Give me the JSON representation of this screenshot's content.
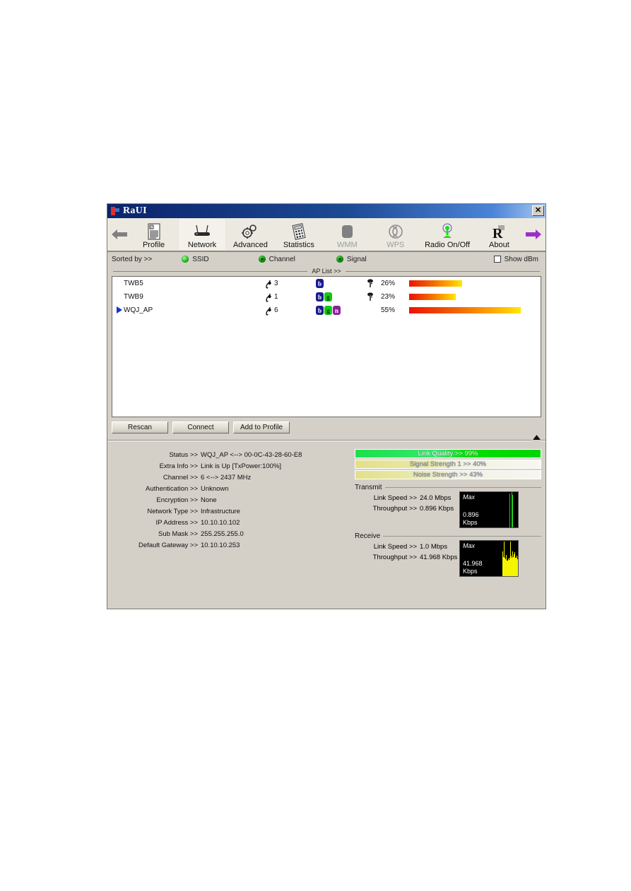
{
  "window": {
    "title": "RaUI",
    "close_label": "✕",
    "title_icon": "raui-logo-icon"
  },
  "toolbar": {
    "prev_arrow": "left-arrow-icon",
    "next_arrow": "right-arrow-icon",
    "tabs": [
      {
        "label": "Profile",
        "icon": "profile-icon",
        "active": false,
        "disabled": false
      },
      {
        "label": "Network",
        "icon": "router-icon",
        "active": true,
        "disabled": false
      },
      {
        "label": "Advanced",
        "icon": "gears-icon",
        "active": false,
        "disabled": false
      },
      {
        "label": "Statistics",
        "icon": "calculator-icon",
        "active": false,
        "disabled": false
      },
      {
        "label": "WMM",
        "icon": "wmm-icon",
        "active": false,
        "disabled": true
      },
      {
        "label": "WPS",
        "icon": "wps-icon",
        "active": false,
        "disabled": true
      },
      {
        "label": "Radio On/Off",
        "icon": "antenna-icon",
        "active": false,
        "disabled": false
      },
      {
        "label": "About",
        "icon": "about-r-icon",
        "active": false,
        "disabled": false
      }
    ]
  },
  "sortbar": {
    "label": "Sorted by >>",
    "options": [
      {
        "label": "SSID",
        "selected": true
      },
      {
        "label": "Channel",
        "selected": false
      },
      {
        "label": "Signal",
        "selected": false
      }
    ],
    "show_dbm": {
      "label": "Show dBm",
      "checked": false
    }
  },
  "aplist": {
    "separator_label": "AP List >>",
    "rows": [
      {
        "selected": false,
        "ssid": "TWB5",
        "channel": "3",
        "modes": [
          "b"
        ],
        "secured": true,
        "signal_pct": "26%",
        "signal_value": 26
      },
      {
        "selected": false,
        "ssid": "TWB9",
        "channel": "1",
        "modes": [
          "b",
          "g"
        ],
        "secured": true,
        "signal_pct": "23%",
        "signal_value": 23
      },
      {
        "selected": true,
        "ssid": "WQJ_AP",
        "channel": "6",
        "modes": [
          "b",
          "g",
          "n"
        ],
        "secured": false,
        "signal_pct": "55%",
        "signal_value": 55
      }
    ]
  },
  "actions": {
    "rescan": "Rescan",
    "connect": "Connect",
    "add_to_profile": "Add to Profile",
    "collapse": "collapse-triangle-icon"
  },
  "status_details": [
    {
      "label": "Status >>",
      "value": "WQJ_AP <--> 00-0C-43-28-60-E8"
    },
    {
      "label": "Extra Info >>",
      "value": "Link is Up [TxPower:100%]"
    },
    {
      "label": "Channel >>",
      "value": "6 <--> 2437 MHz"
    },
    {
      "label": "Authentication >>",
      "value": "Unknown"
    },
    {
      "label": "Encryption >>",
      "value": "None"
    },
    {
      "label": "Network Type >>",
      "value": "Infrastructure"
    },
    {
      "label": "IP Address >>",
      "value": "10.10.10.102"
    },
    {
      "label": "Sub Mask >>",
      "value": "255.255.255.0"
    },
    {
      "label": "Default Gateway >>",
      "value": "10.10.10.253"
    }
  ],
  "quality_bars": [
    {
      "label": "Link Quality >> 99%",
      "value": 99
    },
    {
      "label": "Signal Strength 1 >> 40%",
      "value": 40
    },
    {
      "label": "Noise Strength >> 43%",
      "value": 43
    }
  ],
  "transmit": {
    "title": "Transmit",
    "link_speed_label": "Link Speed >>",
    "link_speed_value": "24.0 Mbps",
    "throughput_label": "Throughput >>",
    "throughput_value": "0.896 Kbps",
    "graph": {
      "max_label": "Max",
      "value_label": "0.896",
      "unit_label": "Kbps",
      "samples": [
        0,
        0,
        0,
        0,
        0,
        0,
        0,
        0,
        0,
        0,
        0,
        0,
        0,
        0,
        0,
        0,
        0,
        0,
        0,
        0,
        0,
        0,
        0,
        0,
        0,
        0,
        0,
        0,
        0,
        96,
        0,
        0,
        100,
        92,
        0,
        0,
        0,
        0,
        0,
        0
      ]
    }
  },
  "receive": {
    "title": "Receive",
    "link_speed_label": "Link Speed >>",
    "link_speed_value": "1.0 Mbps",
    "throughput_label": "Throughput >>",
    "throughput_value": "41.968 Kbps",
    "graph": {
      "max_label": "Max",
      "value_label": "41.968",
      "unit_label": "Kbps",
      "samples": [
        0,
        0,
        0,
        0,
        0,
        0,
        0,
        0,
        0,
        0,
        0,
        0,
        0,
        0,
        0,
        0,
        0,
        0,
        0,
        0,
        70,
        55,
        98,
        52,
        48,
        60,
        45,
        50,
        47,
        52,
        98,
        58,
        52,
        70,
        55,
        62,
        68,
        52,
        58,
        48
      ]
    }
  },
  "colors": {
    "title_bar": "#0a246a",
    "window_face": "#d4d0c8",
    "accent_green": "#14b410",
    "signal_gradient_start": "#ee1100",
    "signal_gradient_end": "#ffe800",
    "tx_graph": "#20cf20",
    "rx_graph": "#f5f500"
  }
}
